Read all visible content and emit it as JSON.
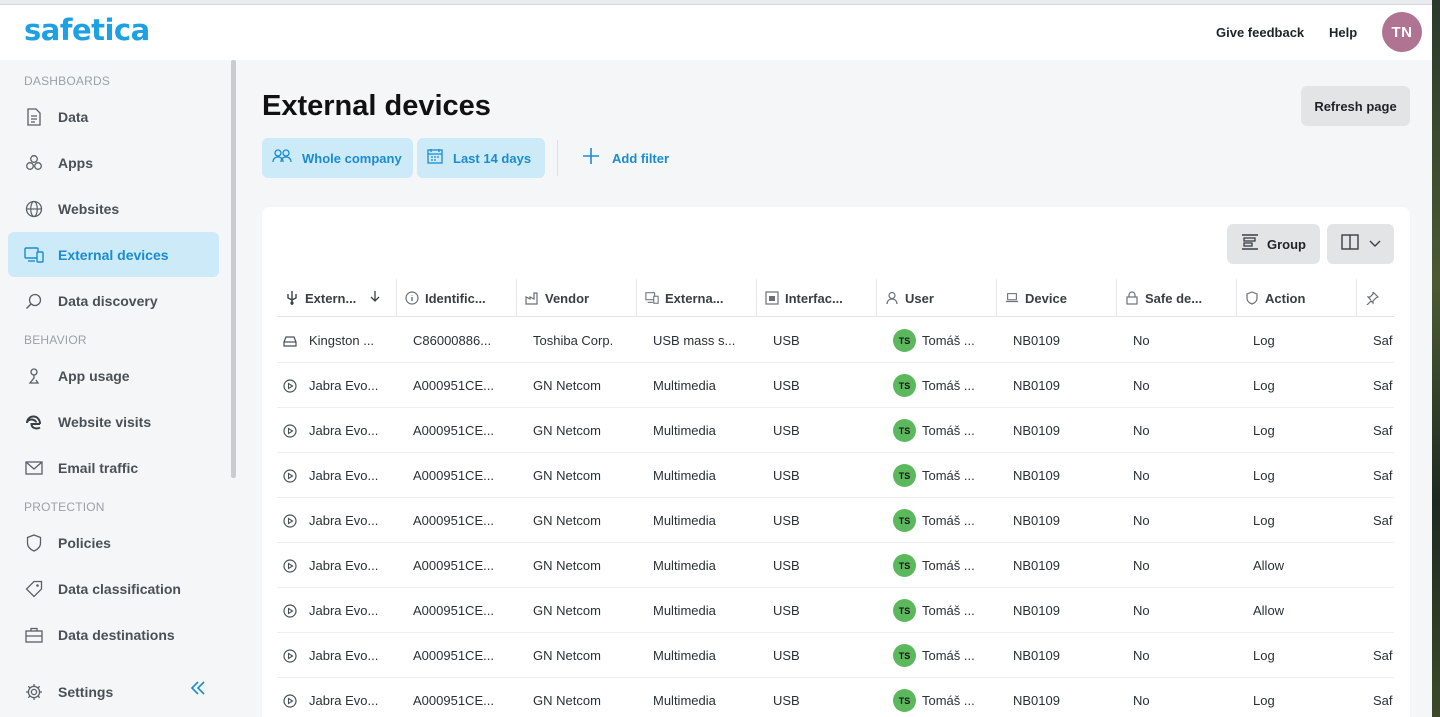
{
  "app": {
    "logo": "safetica"
  },
  "header": {
    "feedback": "Give feedback",
    "help": "Help",
    "avatar": "TN"
  },
  "sidebar": {
    "sections": {
      "dashboards": "DASHBOARDS",
      "behavior": "BEHAVIOR",
      "protection": "PROTECTION"
    },
    "items": [
      {
        "label": "Data",
        "icon": "document-icon"
      },
      {
        "label": "Apps",
        "icon": "apps-icon"
      },
      {
        "label": "Websites",
        "icon": "globe-icon"
      },
      {
        "label": "External devices",
        "icon": "devices-icon"
      },
      {
        "label": "Data discovery",
        "icon": "search-icon"
      },
      {
        "label": "App usage",
        "icon": "app-usage-icon"
      },
      {
        "label": "Website visits",
        "icon": "edge-icon"
      },
      {
        "label": "Email traffic",
        "icon": "mail-icon"
      },
      {
        "label": "Policies",
        "icon": "shield-icon"
      },
      {
        "label": "Data classification",
        "icon": "tag-icon"
      },
      {
        "label": "Data destinations",
        "icon": "briefcase-icon"
      },
      {
        "label": "Settings",
        "icon": "gear-icon"
      }
    ]
  },
  "main": {
    "title": "External devices",
    "refresh": "Refresh page",
    "filters": {
      "scope": "Whole company",
      "range": "Last 14 days",
      "add": "Add filter"
    },
    "toolbar": {
      "group": "Group"
    }
  },
  "table": {
    "columns": [
      "Extern...",
      "Identific...",
      "Vendor",
      "Externa...",
      "Interfac...",
      "User",
      "Device",
      "Safe de...",
      "Action"
    ],
    "rows": [
      {
        "device_name": "Kingston ...",
        "id": "C86000886...",
        "vendor": "Toshiba Corp.",
        "type": "USB mass s...",
        "iface": "USB",
        "user_initials": "TS",
        "user": "Tomáš ...",
        "device": "NB0109",
        "safe": "No",
        "action": "Log",
        "extra": "Saf"
      },
      {
        "device_name": "Jabra Evo...",
        "id": "A000951CE...",
        "vendor": "GN Netcom",
        "type": "Multimedia",
        "iface": "USB",
        "user_initials": "TS",
        "user": "Tomáš ...",
        "device": "NB0109",
        "safe": "No",
        "action": "Log",
        "extra": "Saf"
      },
      {
        "device_name": "Jabra Evo...",
        "id": "A000951CE...",
        "vendor": "GN Netcom",
        "type": "Multimedia",
        "iface": "USB",
        "user_initials": "TS",
        "user": "Tomáš ...",
        "device": "NB0109",
        "safe": "No",
        "action": "Log",
        "extra": "Saf"
      },
      {
        "device_name": "Jabra Evo...",
        "id": "A000951CE...",
        "vendor": "GN Netcom",
        "type": "Multimedia",
        "iface": "USB",
        "user_initials": "TS",
        "user": "Tomáš ...",
        "device": "NB0109",
        "safe": "No",
        "action": "Log",
        "extra": "Saf"
      },
      {
        "device_name": "Jabra Evo...",
        "id": "A000951CE...",
        "vendor": "GN Netcom",
        "type": "Multimedia",
        "iface": "USB",
        "user_initials": "TS",
        "user": "Tomáš ...",
        "device": "NB0109",
        "safe": "No",
        "action": "Log",
        "extra": "Saf"
      },
      {
        "device_name": "Jabra Evo...",
        "id": "A000951CE...",
        "vendor": "GN Netcom",
        "type": "Multimedia",
        "iface": "USB",
        "user_initials": "TS",
        "user": "Tomáš ...",
        "device": "NB0109",
        "safe": "No",
        "action": "Allow",
        "extra": ""
      },
      {
        "device_name": "Jabra Evo...",
        "id": "A000951CE...",
        "vendor": "GN Netcom",
        "type": "Multimedia",
        "iface": "USB",
        "user_initials": "TS",
        "user": "Tomáš ...",
        "device": "NB0109",
        "safe": "No",
        "action": "Allow",
        "extra": ""
      },
      {
        "device_name": "Jabra Evo...",
        "id": "A000951CE...",
        "vendor": "GN Netcom",
        "type": "Multimedia",
        "iface": "USB",
        "user_initials": "TS",
        "user": "Tomáš ...",
        "device": "NB0109",
        "safe": "No",
        "action": "Log",
        "extra": "Saf"
      },
      {
        "device_name": "Jabra Evo...",
        "id": "A000951CE...",
        "vendor": "GN Netcom",
        "type": "Multimedia",
        "iface": "USB",
        "user_initials": "TS",
        "user": "Tomáš ...",
        "device": "NB0109",
        "safe": "No",
        "action": "Log",
        "extra": "Saf"
      }
    ]
  },
  "colors": {
    "accent": "#1a8ccf",
    "active_bg": "#cdeaf9",
    "avatar": "#b07391",
    "user_badge": "#5cb85c"
  }
}
